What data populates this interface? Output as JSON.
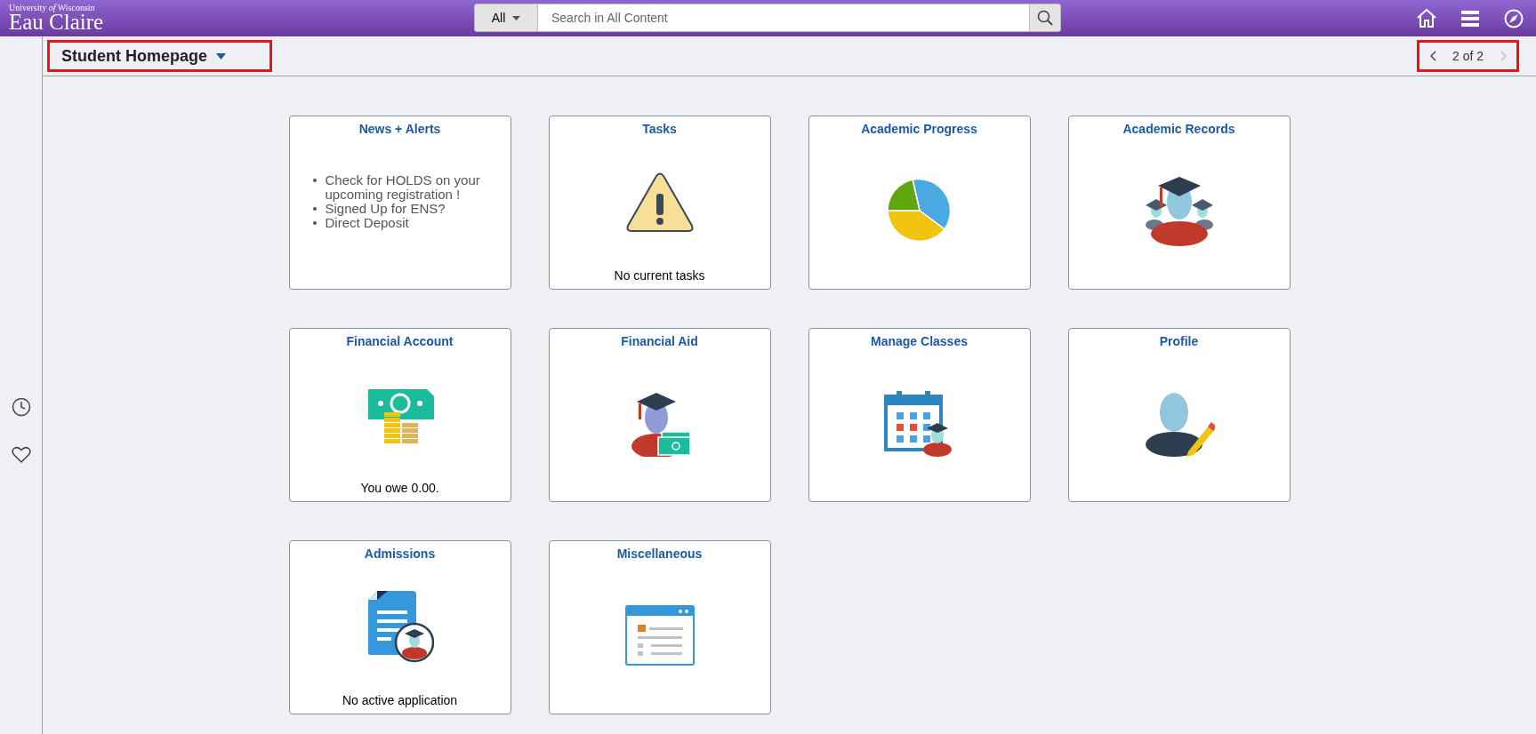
{
  "header": {
    "logo_small": "University *of* Wisconsin",
    "logo_large": "Eau Claire",
    "search": {
      "scope": "All",
      "placeholder": "Search in All Content"
    }
  },
  "page_title": "Student Homepage",
  "pager": {
    "label": "2 of 2",
    "prev_disabled": false,
    "next_disabled": true
  },
  "tiles": [
    {
      "title": "News + Alerts",
      "kind": "news",
      "bullets": [
        "Check for HOLDS on your upcoming registration !",
        "Signed Up for ENS?",
        "Direct Deposit"
      ]
    },
    {
      "title": "Tasks",
      "kind": "warning",
      "footer": "No current tasks"
    },
    {
      "title": "Academic Progress",
      "kind": "pie"
    },
    {
      "title": "Academic Records",
      "kind": "graduates"
    },
    {
      "title": "Financial Account",
      "kind": "money",
      "footer": "You owe 0.00."
    },
    {
      "title": "Financial Aid",
      "kind": "aid"
    },
    {
      "title": "Manage Classes",
      "kind": "calendar"
    },
    {
      "title": "Profile",
      "kind": "profile"
    },
    {
      "title": "Admissions",
      "kind": "document",
      "footer": "No active application"
    },
    {
      "title": "Miscellaneous",
      "kind": "window"
    }
  ]
}
